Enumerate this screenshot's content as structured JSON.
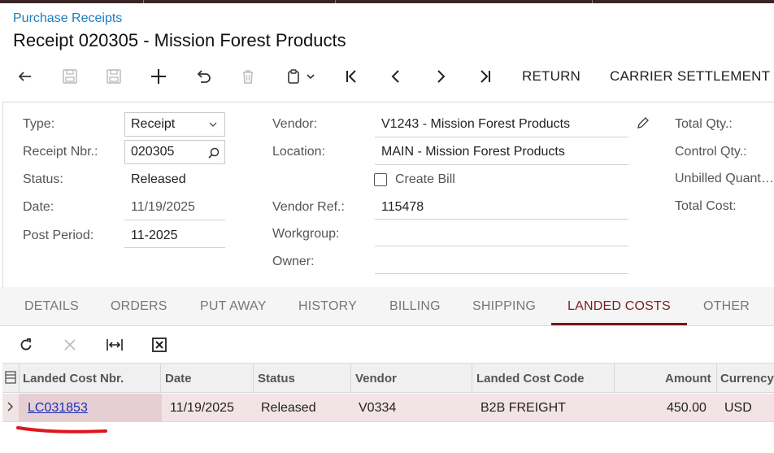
{
  "header": {
    "breadcrumb": "Purchase Receipts",
    "title": "Receipt 020305 - Mission Forest Products"
  },
  "toolbar": {
    "return_label": "RETURN",
    "carrier_settlement_label": "CARRIER SETTLEMENT"
  },
  "form": {
    "type_label": "Type:",
    "type_value": "Receipt",
    "receipt_nbr_label": "Receipt Nbr.:",
    "receipt_nbr_value": "020305",
    "status_label": "Status:",
    "status_value": "Released",
    "date_label": "Date:",
    "date_value": "11/19/2025",
    "post_period_label": "Post Period:",
    "post_period_value": "11-2025",
    "vendor_label": "Vendor:",
    "vendor_value": "V1243 - Mission Forest Products",
    "location_label": "Location:",
    "location_value": "MAIN - Mission Forest Products",
    "create_bill_label": "Create Bill",
    "create_bill_checked": false,
    "vendor_ref_label": "Vendor Ref.:",
    "vendor_ref_value": "115478",
    "workgroup_label": "Workgroup:",
    "workgroup_value": "",
    "owner_label": "Owner:",
    "owner_value": "",
    "total_qty_label": "Total Qty.:",
    "control_qty_label": "Control Qty.:",
    "unbilled_qty_label": "Unbilled Quant…",
    "total_cost_label": "Total Cost:"
  },
  "tabs": [
    {
      "label": "DETAILS",
      "active": false
    },
    {
      "label": "ORDERS",
      "active": false
    },
    {
      "label": "PUT AWAY",
      "active": false
    },
    {
      "label": "HISTORY",
      "active": false
    },
    {
      "label": "BILLING",
      "active": false
    },
    {
      "label": "SHIPPING",
      "active": false
    },
    {
      "label": "LANDED COSTS",
      "active": true
    },
    {
      "label": "OTHER",
      "active": false
    }
  ],
  "grid": {
    "columns": [
      "Landed Cost Nbr.",
      "Date",
      "Status",
      "Vendor",
      "Landed Cost Code",
      "Amount",
      "Currency"
    ],
    "rows": [
      {
        "nbr": "LC031853",
        "date": "11/19/2025",
        "status": "Released",
        "vendor": "V0334",
        "code": "B2B FREIGHT",
        "amount": "450.00",
        "currency": "USD"
      }
    ]
  },
  "colors": {
    "accent": "#7a1d1d",
    "link": "#1a2fb8",
    "breadcrumb": "#1a7dbf",
    "selected_row": "#f2e4e6",
    "annotation": "#e0141e"
  }
}
